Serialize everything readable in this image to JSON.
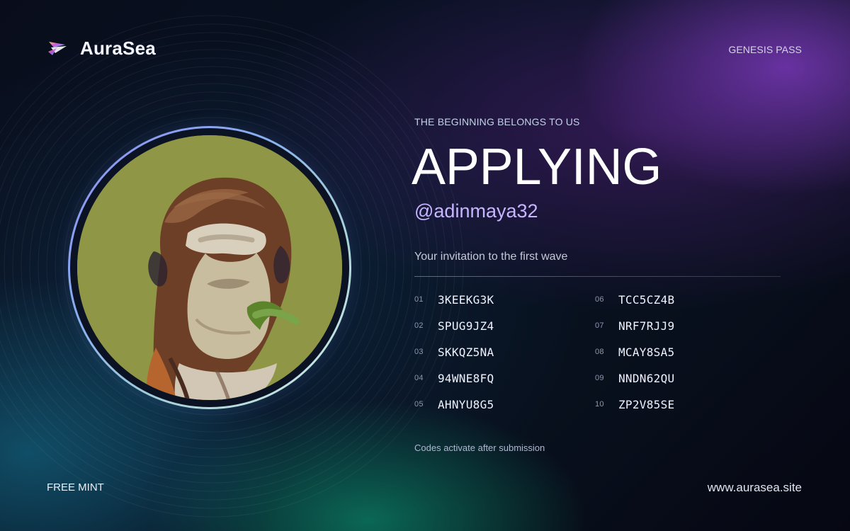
{
  "brand": {
    "name": "AuraSea",
    "logo_icon": "logo-mark"
  },
  "header": {
    "right_label": "GENESIS PASS"
  },
  "profile": {
    "eyebrow": "THE BEGINNING BELONGS TO US",
    "status": "APPLYING",
    "handle": "@adinmaya32",
    "subtitle": "Your invitation to the first wave",
    "avatar_icon": "ape-avatar"
  },
  "codes": [
    {
      "num": "01",
      "value": "3KEEKG3K"
    },
    {
      "num": "02",
      "value": "SPUG9JZ4"
    },
    {
      "num": "03",
      "value": "SKKQZ5NA"
    },
    {
      "num": "04",
      "value": "94WNE8FQ"
    },
    {
      "num": "05",
      "value": "AHNYU8G5"
    },
    {
      "num": "06",
      "value": "TCC5CZ4B"
    },
    {
      "num": "07",
      "value": "NRF7RJJ9"
    },
    {
      "num": "08",
      "value": "MCAY8SA5"
    },
    {
      "num": "09",
      "value": "NNDN62QU"
    },
    {
      "num": "10",
      "value": "ZP2V85SE"
    }
  ],
  "footer": {
    "note": "Codes activate after submission",
    "left_label": "FREE MINT",
    "right_label": "www.aurasea.site"
  },
  "colors": {
    "background": "#070914",
    "accent_purple": "#7d3abe",
    "accent_teal": "#1673a0",
    "accent_green": "#0c896a",
    "handle": "#c7b5ff"
  }
}
